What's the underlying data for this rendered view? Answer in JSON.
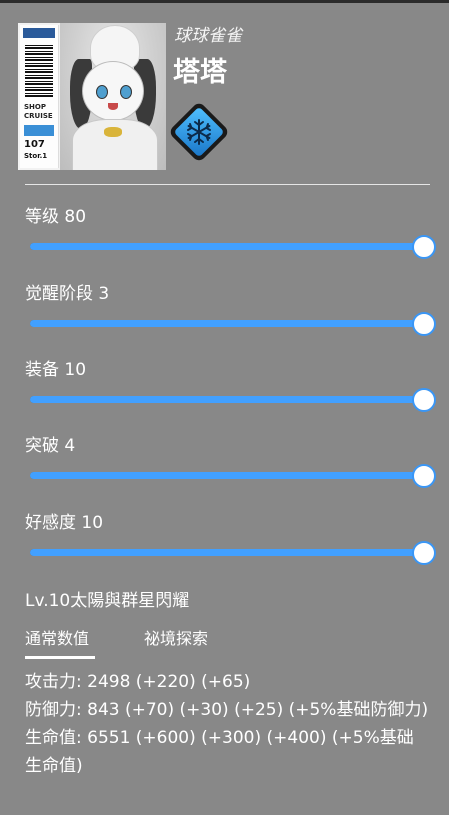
{
  "header": {
    "subtitle": "球球雀雀",
    "name": "塔塔",
    "element_icon": "snowflake-icon",
    "card": {
      "strip_lines": [
        "SHOP",
        "CRUISE"
      ],
      "strip_number_top": "107",
      "strip_number_bottom": "Stor.1"
    }
  },
  "sliders": [
    {
      "key": "level",
      "label": "等级 80",
      "fraction": 1.0
    },
    {
      "key": "awakening",
      "label": "觉醒阶段 3",
      "fraction": 1.0
    },
    {
      "key": "equipment",
      "label": "装备 10",
      "fraction": 1.0
    },
    {
      "key": "breakthrough",
      "label": "突破 4",
      "fraction": 1.0
    },
    {
      "key": "affection",
      "label": "好感度 10",
      "fraction": 1.0
    }
  ],
  "skill": "Lv.10太陽與群星閃耀",
  "tabs": [
    {
      "label": "通常数值",
      "active": true
    },
    {
      "label": "祕境探索",
      "active": false
    }
  ],
  "stats": [
    "攻击力: 2498 (+220) (+65)",
    "防御力: 843 (+70) (+30) (+25) (+5%基础防御力)",
    "生命值: 6551 (+600) (+300) (+400) (+5%基础生命值)"
  ],
  "colors": {
    "background": "#888888",
    "slider_fill": "#42a0ff",
    "slider_thumb_border": "#3a96f5",
    "element_badge": "#1a76c8"
  }
}
